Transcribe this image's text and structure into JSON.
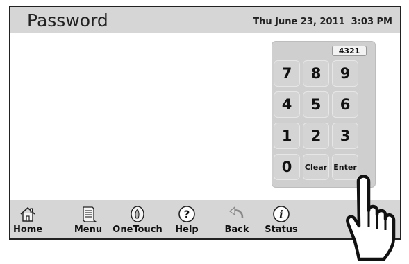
{
  "header": {
    "title": "Password",
    "datetime": "Thu June 23, 2011  3:03 PM"
  },
  "keypad": {
    "entry_value": "4321",
    "keys": [
      "7",
      "8",
      "9",
      "4",
      "5",
      "6",
      "1",
      "2",
      "3",
      "0",
      "Clear",
      "Enter"
    ]
  },
  "taskbar": {
    "items": [
      {
        "label": "Home",
        "icon": "home-icon"
      },
      {
        "label": "Menu",
        "icon": "menu-icon"
      },
      {
        "label": "OneTouch",
        "icon": "onetouch-icon"
      },
      {
        "label": "Help",
        "icon": "help-icon"
      },
      {
        "label": "Back",
        "icon": "back-icon"
      },
      {
        "label": "Status",
        "icon": "status-icon"
      }
    ]
  },
  "overlay": {
    "icon": "pointing-hand-icon"
  }
}
